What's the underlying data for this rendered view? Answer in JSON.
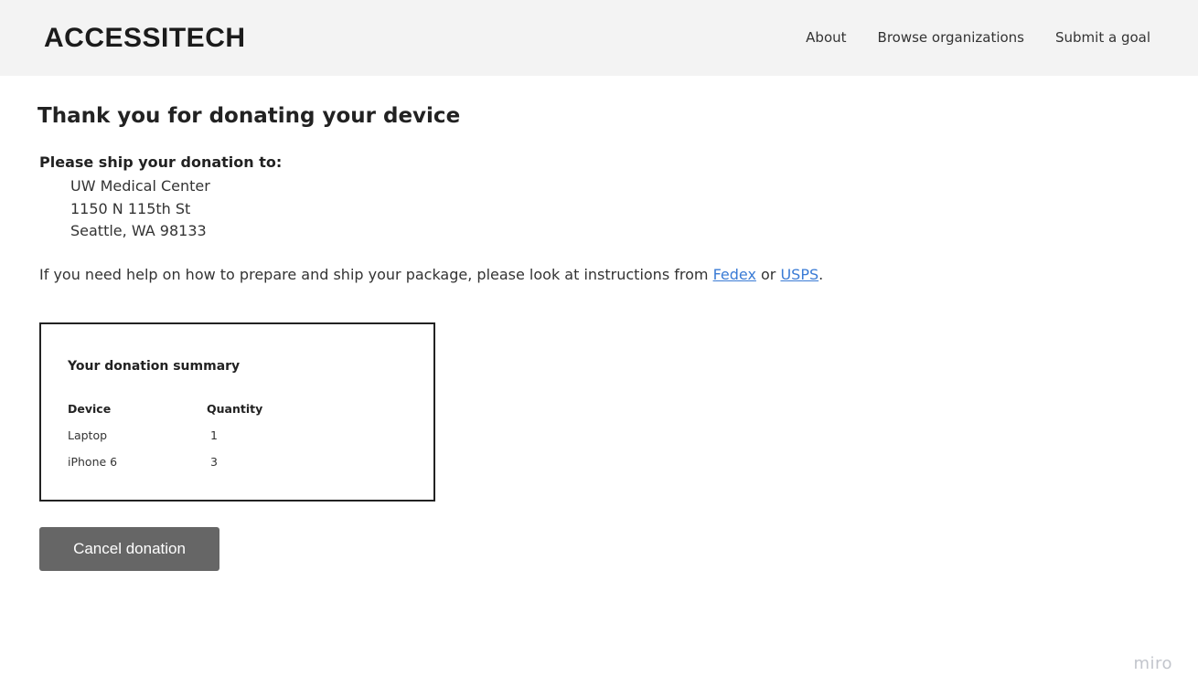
{
  "header": {
    "logo": "ACCESSITECH",
    "nav": {
      "about": "About",
      "browse": "Browse organizations",
      "submit": "Submit a goal"
    }
  },
  "main": {
    "title": "Thank you for donating your device",
    "ship_label": "Please ship your donation to:",
    "address": {
      "line1": "UW Medical Center",
      "line2": "1150 N 115th St",
      "line3": "Seattle, WA 98133"
    },
    "help": {
      "prefix": "If you need help on how to prepare and ship your package, please look at instructions from ",
      "fedex": "Fedex",
      "middle": " or ",
      "usps": "USPS",
      "suffix": "."
    },
    "summary": {
      "title": "Your donation summary",
      "columns": [
        "Device",
        "Quantity"
      ],
      "rows": [
        {
          "device": "Laptop",
          "quantity": "1"
        },
        {
          "device": "iPhone 6",
          "quantity": "3"
        }
      ]
    },
    "cancel_label": "Cancel donation"
  },
  "watermark": "miro",
  "colors": {
    "header_bg": "#f3f3f3",
    "link": "#3a7bd5",
    "button_bg": "#666666"
  }
}
